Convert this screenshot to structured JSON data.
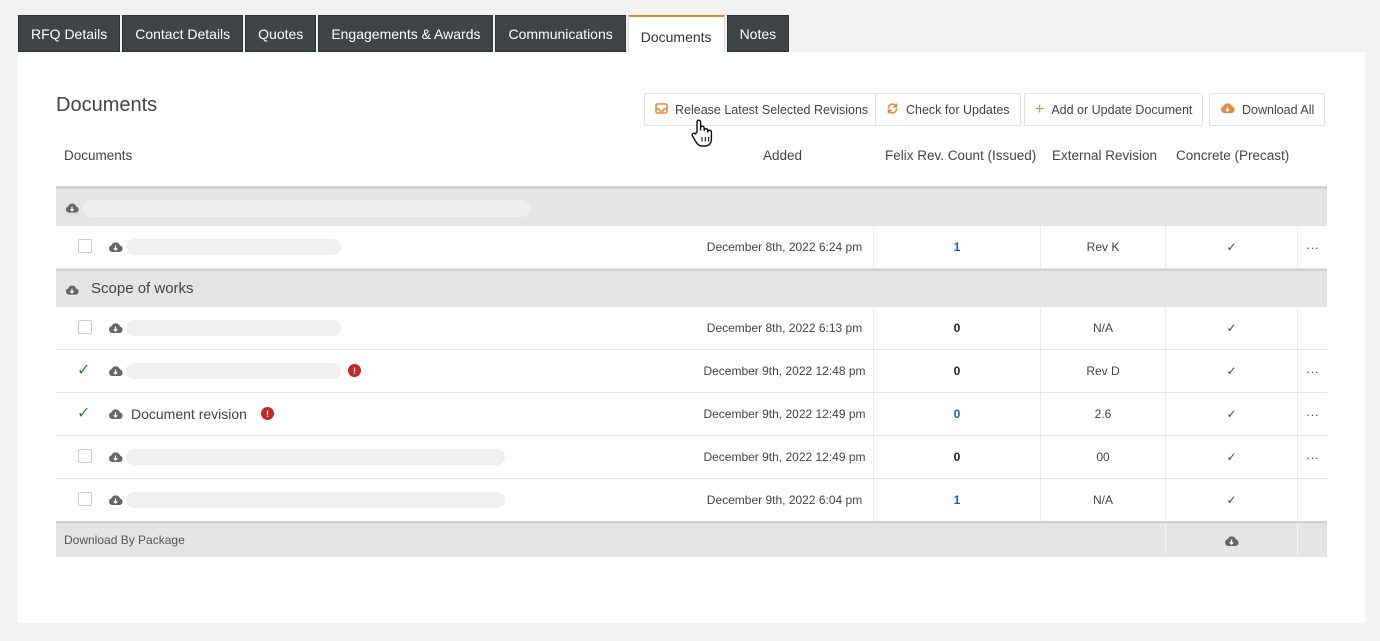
{
  "tabs": [
    {
      "label": "RFQ Details"
    },
    {
      "label": "Contact Details"
    },
    {
      "label": "Quotes"
    },
    {
      "label": "Engagements & Awards"
    },
    {
      "label": "Communications"
    },
    {
      "label": "Documents"
    },
    {
      "label": "Notes"
    }
  ],
  "active_tab": "Documents",
  "section": {
    "title": "Documents"
  },
  "toolbar": {
    "release": "Release Latest Selected Revisions",
    "check": "Check for Updates",
    "add": "Add or Update Document",
    "download_all": "Download All"
  },
  "table": {
    "headers": {
      "documents": "Documents",
      "added": "Added",
      "rev_count": "Felix Rev. Count (Issued)",
      "external": "External Revision",
      "concrete": "Concrete (Precast)"
    },
    "group1": {
      "name": ""
    },
    "group2": {
      "name": "Scope of works"
    },
    "rows": [
      {
        "name": "",
        "added": "December 8th, 2022 6:24 pm",
        "count": "1",
        "external": "Rev K",
        "concrete": "✓",
        "more": "···",
        "checked": false
      },
      {
        "name": "",
        "added": "December 8th, 2022 6:13 pm",
        "count": "0",
        "external": "N/A",
        "concrete": "✓",
        "more": "",
        "checked": false
      },
      {
        "name": "",
        "added": "December 9th, 2022 12:48 pm",
        "count": "0",
        "external": "Rev D",
        "concrete": "✓",
        "more": "···",
        "checked": true
      },
      {
        "name": "Document revision",
        "added": "December 9th, 2022 12:49 pm",
        "count": "0",
        "external": "2.6",
        "concrete": "✓",
        "more": "···",
        "checked": true
      },
      {
        "name": "",
        "added": "December 9th, 2022 12:49 pm",
        "count": "0",
        "external": "00",
        "concrete": "✓",
        "more": "···",
        "checked": false
      },
      {
        "name": "",
        "added": "December 9th, 2022 6:04 pm",
        "count": "1",
        "external": "N/A",
        "concrete": "✓",
        "more": "",
        "checked": false
      }
    ],
    "footer": {
      "label": "Download By Package"
    }
  },
  "colors": {
    "accent": "#e8873a",
    "tab_dark": "#3f4447",
    "link": "#1a5fb4",
    "alert": "#c62828",
    "check": "#2e8b3a"
  }
}
